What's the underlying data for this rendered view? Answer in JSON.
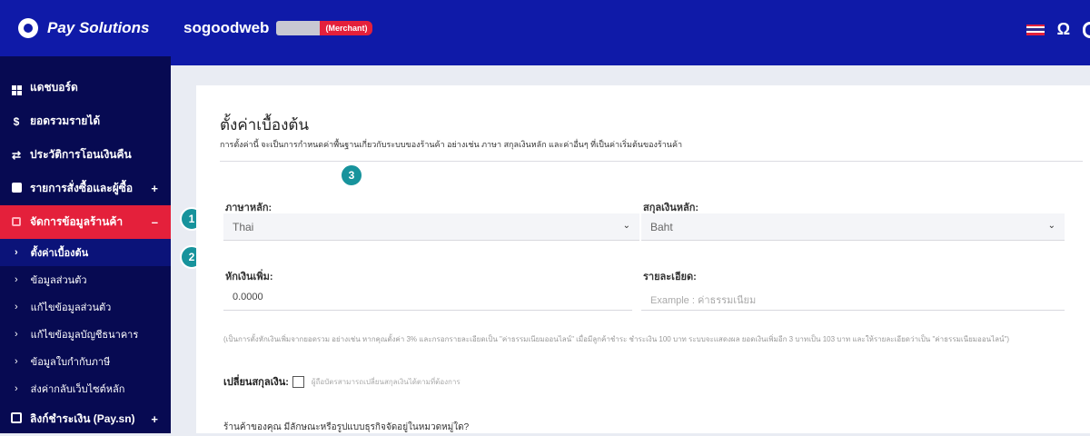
{
  "topbar": {
    "brand": "Pay Solutions",
    "shop_name": "sogoodweb",
    "merchant_badge": "(Merchant)",
    "icons": [
      "thai-flag-icon",
      "headset-icon"
    ]
  },
  "sidebar": {
    "items": [
      {
        "label": "แดชบอร์ด",
        "icon": "dashboard-icon"
      },
      {
        "label": "ยอดรวมรายได้",
        "icon": "dollar-icon"
      },
      {
        "label": "ประวัติการโอนเงินคืน",
        "icon": "transfer-icon"
      },
      {
        "label": "รายการสั่งซื้อและผู้ซื้อ",
        "icon": "document-icon",
        "expander": "+"
      },
      {
        "label": "จัดการข้อมูลร้านค้า",
        "icon": "shop-icon",
        "expander": "–",
        "active": true
      }
    ],
    "subitems": [
      {
        "label": "ตั้งค่าเบื้องต้น",
        "current": true
      },
      {
        "label": "ข้อมูลส่วนตัว"
      },
      {
        "label": "แก้ไขข้อมูลส่วนตัว"
      },
      {
        "label": "แก้ไขข้อมูลบัญชีธนาคาร"
      },
      {
        "label": "ข้อมูลใบกำกับภาษี"
      },
      {
        "label": "ส่งค่ากลับเว็บไซต์หลัก"
      }
    ],
    "bottom_item": {
      "label": "ลิงก์ชำระเงิน (Pay.sn)",
      "icon": "link-payment-icon",
      "expander": "+"
    }
  },
  "badges": [
    "1",
    "2",
    "3"
  ],
  "main": {
    "title": "ตั้งค่าเบื้องต้น",
    "description": "การตั้งค่านี้ จะเป็นการกำหนดค่าพื้นฐานเกี่ยวกับระบบของร้านค้า อย่างเช่น ภาษา สกุลเงินหลัก และค่าอื่นๆ ที่เป็นค่าเริ่มต้นของร้านค้า",
    "language": {
      "label": "ภาษาหลัก:",
      "value": "Thai"
    },
    "currency": {
      "label": "สกุลเงินหลัก:",
      "value": "Baht"
    },
    "extra_fee": {
      "label": "หักเงินเพิ่ม:",
      "value": "0.0000"
    },
    "detail": {
      "label": "รายละเอียด:",
      "placeholder": "Example : ค่าธรรมเนียม"
    },
    "hint": "(เป็นการตั้งหักเงินเพิ่มจากยอดรวม อย่างเช่น หากคุณตั้งค่า 3% และกรอกรายละเอียดเป็น \"ค่าธรรมเนียมออนไลน์\" เมื่อมีลูกค้าชำระ ชำระเงิน 100 บาท ระบบจะแสดงผล ยอดเงินเพิ่มอีก 3 บาทเป็น 103 บาท และให้รายละเอียดว่าเป็น \"ค่าธรรมเนียมออนไลน์\")",
    "change_currency": {
      "label": "เปลี่ยนสกุลเงิน:",
      "note": "ผู้ถือบัตรสามารถเปลี่ยนสกุลเงินได้ตามที่ต้องการ"
    },
    "question": "ร้านค้าของคุณ มีลักษณะหรือรูปแบบธุรกิจจัดอยู่ในหมวดหมู่ใด?"
  },
  "colors": {
    "topbar": "#0f1aa8",
    "sidebar": "#070a52",
    "active": "#e4203b",
    "badge": "#17939c"
  }
}
